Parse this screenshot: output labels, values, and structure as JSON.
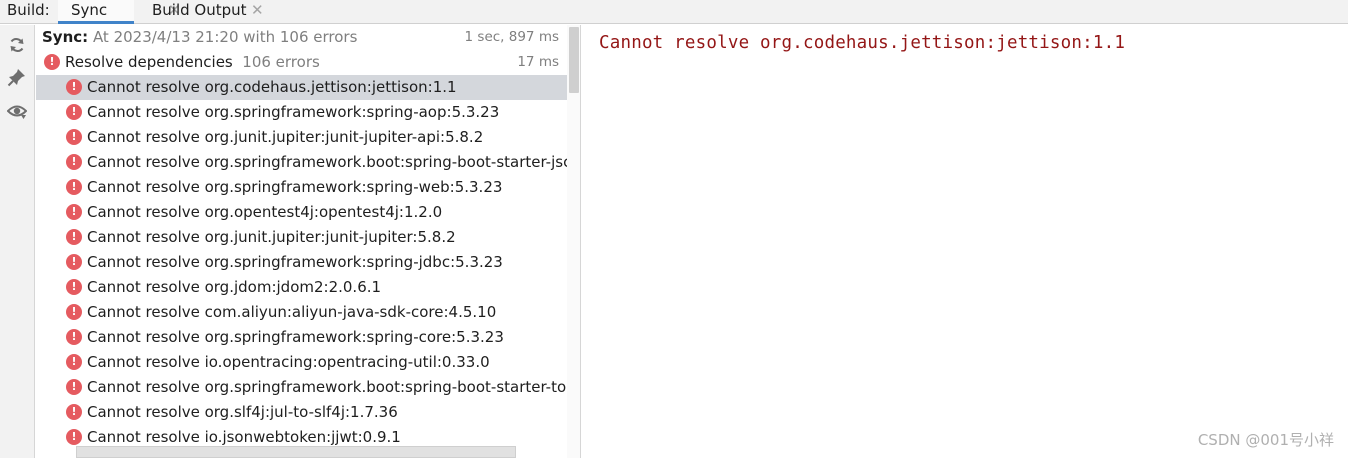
{
  "tabbar": {
    "label": "Build:",
    "tabs": [
      {
        "label": "Sync",
        "active": true
      },
      {
        "label": "Build Output",
        "active": false
      }
    ]
  },
  "toolstrip": {
    "icons": [
      "refresh-icon",
      "pin-icon",
      "eye-icon"
    ]
  },
  "tree": {
    "sync": {
      "label": "Sync:",
      "detail": "At 2023/4/13 21:20 with 106 errors",
      "timing": "1 sec, 897 ms"
    },
    "resolve": {
      "label": "Resolve dependencies",
      "count": "106 errors",
      "timing": "17 ms"
    },
    "errors": [
      "Cannot resolve org.codehaus.jettison:jettison:1.1",
      "Cannot resolve org.springframework:spring-aop:5.3.23",
      "Cannot resolve org.junit.jupiter:junit-jupiter-api:5.8.2",
      "Cannot resolve org.springframework.boot:spring-boot-starter-jsc",
      "Cannot resolve org.springframework:spring-web:5.3.23",
      "Cannot resolve org.opentest4j:opentest4j:1.2.0",
      "Cannot resolve org.junit.jupiter:junit-jupiter:5.8.2",
      "Cannot resolve org.springframework:spring-jdbc:5.3.23",
      "Cannot resolve org.jdom:jdom2:2.0.6.1",
      "Cannot resolve com.aliyun:aliyun-java-sdk-core:4.5.10",
      "Cannot resolve org.springframework:spring-core:5.3.23",
      "Cannot resolve io.opentracing:opentracing-util:0.33.0",
      "Cannot resolve org.springframework.boot:spring-boot-starter-to",
      "Cannot resolve org.slf4j:jul-to-slf4j:1.7.36",
      "Cannot resolve io.jsonwebtoken:jjwt:0.9.1"
    ],
    "selected_index": 0
  },
  "detail": {
    "message": "Cannot resolve org.codehaus.jettison:jettison:1.1"
  },
  "watermark": "CSDN @001号小祥",
  "colors": {
    "error": "#e55b60",
    "detail_text": "#941616",
    "selection": "#d4d7dc",
    "tab_underline": "#4083c9"
  }
}
